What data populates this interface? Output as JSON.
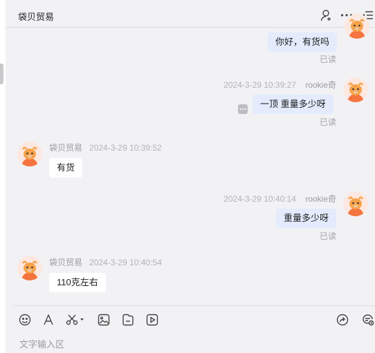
{
  "header": {
    "title": "袋贝贸易",
    "icons": [
      "user-add-icon",
      "more-dots-icon",
      "list-menu-icon"
    ]
  },
  "messages": [
    {
      "side": "me",
      "text": "你好，有货吗",
      "status": "已读"
    },
    {
      "side": "me",
      "sender": "rookie奇",
      "time": "2024-3-29 10:39:27",
      "text": "一顶  重量多少呀",
      "status": "已读"
    },
    {
      "side": "them",
      "sender": "袋贝贸易",
      "time": "2024-3-29 10:39:52",
      "text": "有货"
    },
    {
      "side": "me",
      "sender": "rookie奇",
      "time": "2024-3-29 10:40:14",
      "text": "重量多少呀",
      "status": "已读"
    },
    {
      "side": "them",
      "sender": "袋贝贸易",
      "time": "2024-3-29 10:40:54",
      "text": "110克左右"
    }
  ],
  "toolbar": {
    "left_icons": [
      "emoji-icon",
      "font-icon",
      "scissors-icon",
      "image-icon",
      "file-icon",
      "video-icon"
    ],
    "right_icons": [
      "share-icon",
      "chat-history-icon"
    ]
  },
  "input": {
    "placeholder": "文字输入区"
  },
  "colors": {
    "my_bubble": "#e3ebfd",
    "their_bubble": "#ffffff",
    "avatar_orange": "#f5743f"
  }
}
